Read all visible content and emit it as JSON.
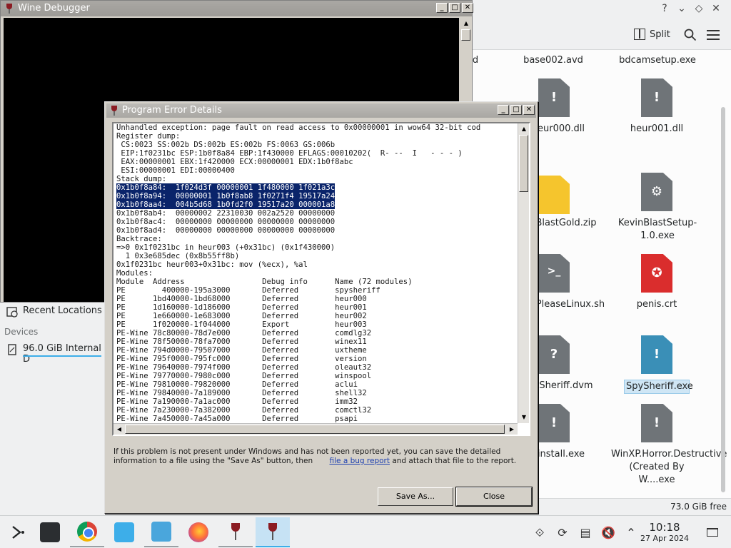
{
  "file_manager": {
    "split_label": "Split",
    "free_space": "73.0 GiB free",
    "files": [
      {
        "label": "d"
      },
      {
        "label": "base002.avd"
      },
      {
        "label": "bdcamsetup.exe"
      },
      {
        "label": "eur000.dll"
      },
      {
        "label": "heur001.dll"
      },
      {
        "label": "BlastGold.zip"
      },
      {
        "label": "KevinBlastSetup-1.0.exe"
      },
      {
        "label": "sPleaseLinux.sh"
      },
      {
        "label": "penis.crt"
      },
      {
        "label": "Sheriff.dvm"
      },
      {
        "label": "SpySheriff.exe"
      },
      {
        "label": "install.exe"
      },
      {
        "label": "WinXP.Horror.Destructive (Created By W....exe"
      }
    ]
  },
  "sidebar": {
    "recent_locations": "Recent Locations",
    "devices_heading": "Devices",
    "drive_label": "96.0 GiB Internal D"
  },
  "wine_debugger": {
    "title": "Wine Debugger"
  },
  "error_dialog": {
    "title": "Program Error Details",
    "lines": [
      "Unhandled exception: page fault on read access to 0x00000001 in wow64 32-bit cod",
      "Register dump:",
      " CS:0023 SS:002b DS:002b ES:002b FS:0063 GS:006b",
      " EIP:1f0231bc ESP:1b0f8a84 EBP:1f430000 EFLAGS:00010202(  R- --  I   - - - )",
      " EAX:00000001 EBX:1f420000 ECX:00000001 EDX:1b0f8abc",
      " ESI:00000001 EDI:00000400",
      "Stack dump:",
      "0x1b0f8a84:  1f024d3f 00000001 1f480000 1f021a3c",
      "0x1b0f8a94:  00000001 1b0f8ab8 1f0271f4 19517a24",
      "0x1b0f8aa4:  004b5d68 1b0fd2f0 19517a20 000001a8",
      "0x1b0f8ab4:  00000002 22310030 002a2520 00000000",
      "0x1b0f8ac4:  00000000 00000000 00000000 00000000",
      "0x1b0f8ad4:  00000000 00000000 00000000 00000000",
      "Backtrace:",
      "=>0 0x1f0231bc in heur003 (+0x31bc) (0x1f430000)",
      "  1 0x3e685dec (0x8b55ff8b)",
      "0x1f0231bc heur003+0x31bc: mov (%ecx), %al",
      "Modules:",
      "Module  Address                 Debug info      Name (72 modules)",
      "PE        400000-195a3000       Deferred        spysheriff",
      "PE      1bd40000-1bd68000       Deferred        heur000",
      "PE      1d160000-1d186000       Deferred        heur001",
      "PE      1e660000-1e683000       Deferred        heur002",
      "PE      1f020000-1f044000       Export          heur003",
      "PE-Wine 78c80000-78d7e000       Deferred        comdlg32",
      "PE-Wine 78f50000-78fa7000       Deferred        winex11",
      "PE-Wine 794d0000-79507000       Deferred        uxtheme",
      "PE-Wine 795f0000-795fc000       Deferred        version",
      "PE-Wine 79640000-7974f000       Deferred        oleaut32",
      "PE-Wine 79770000-7980c000       Deferred        winspool",
      "PE-Wine 79810000-79820000       Deferred        aclui",
      "PE-Wine 79840000-7a189000       Deferred        shell32",
      "PE-Wine 7a190000-7a1ac000       Deferred        imm32",
      "PE-Wine 7a230000-7a382000       Deferred        comctl32",
      "PE-Wine 7a450000-7a45a000       Deferred        psapi"
    ],
    "info_line1": "If this problem is not present under Windows and has not been reported yet, you can save the detailed",
    "info_line2_pre": "information to a file using the \"Save As\" button, then",
    "info_link": "file a bug report",
    "info_line2_post": "and attach that file to the report.",
    "save_as_label": "Save As...",
    "close_label": "Close"
  },
  "taskbar": {
    "time": "10:18",
    "date": "27 Apr 2024"
  }
}
